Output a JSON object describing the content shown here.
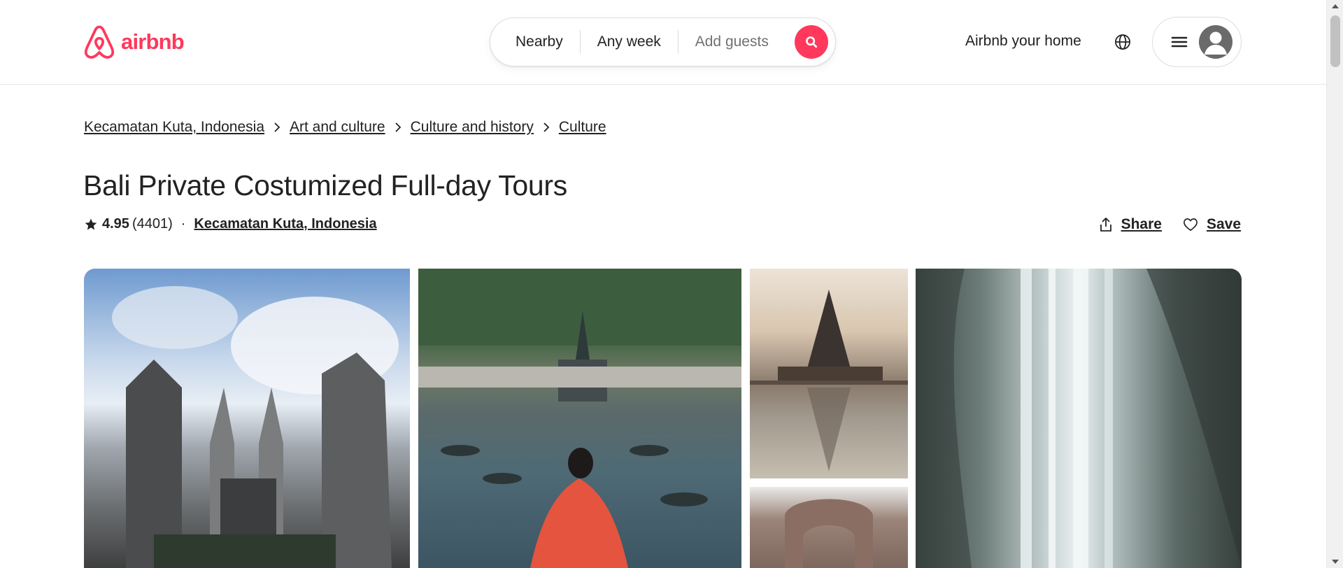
{
  "header": {
    "logo_text": "airbnb",
    "search": {
      "location": "Nearby",
      "dates": "Any week",
      "guests_placeholder": "Add guests"
    },
    "host_link": "Airbnb your home"
  },
  "breadcrumb": [
    "Kecamatan Kuta, Indonesia",
    "Art and culture",
    "Culture and history",
    "Culture"
  ],
  "listing": {
    "title": "Bali Private Costumized Full-day Tours",
    "rating": "4.95",
    "review_count": "(4401)",
    "separator": "·",
    "location": "Kecamatan Kuta, Indonesia",
    "share_label": "Share",
    "save_label": "Save"
  },
  "gallery": [
    {
      "subject": "temple-gate-photo"
    },
    {
      "subject": "water-palace-photo"
    },
    {
      "subject": "lake-pagoda-photo"
    },
    {
      "subject": "carved-arch-photo"
    },
    {
      "subject": "waterfall-photo"
    }
  ],
  "colors": {
    "brand": "#FF385C",
    "text": "#222222",
    "muted": "#717171",
    "border": "#DDDDDD"
  },
  "icons": [
    "airbnb-logo-icon",
    "search-icon",
    "globe-icon",
    "hamburger-menu-icon",
    "user-avatar-icon",
    "chevron-right-icon",
    "star-icon",
    "share-icon",
    "heart-icon"
  ]
}
